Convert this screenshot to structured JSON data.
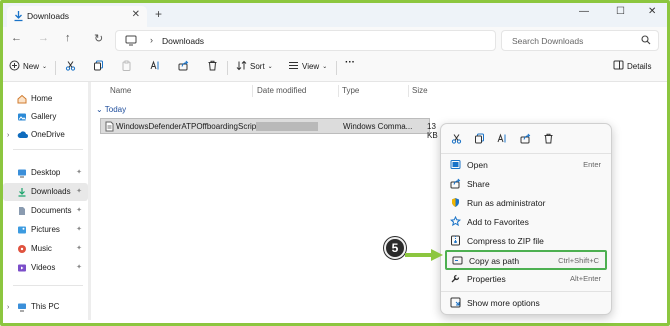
{
  "window": {
    "tab_title": "Downloads",
    "tab_close": "✕",
    "new_tab": "+",
    "controls": [
      "—",
      "☐",
      "✕"
    ]
  },
  "nav": {
    "back": "←",
    "forward": "→",
    "up": "↑",
    "refresh": "↻",
    "chevron": "›",
    "path": "Downloads",
    "search_placeholder": "Search Downloads"
  },
  "toolbar": {
    "new_label": "New",
    "sort_label": "Sort",
    "view_label": "View",
    "more_label": "···",
    "details_label": "Details"
  },
  "sidebar": {
    "items": [
      {
        "label": "Home",
        "icon": "home-icon"
      },
      {
        "label": "Gallery",
        "icon": "gallery-icon"
      },
      {
        "label": "OneDrive",
        "icon": "cloud-icon"
      },
      {
        "label": "Desktop",
        "icon": "desktop-icon"
      },
      {
        "label": "Downloads",
        "icon": "download-icon"
      },
      {
        "label": "Documents",
        "icon": "documents-icon"
      },
      {
        "label": "Pictures",
        "icon": "pictures-icon"
      },
      {
        "label": "Music",
        "icon": "music-icon"
      },
      {
        "label": "Videos",
        "icon": "videos-icon"
      },
      {
        "label": "This PC",
        "icon": "pc-icon"
      }
    ],
    "pin": "📌"
  },
  "list": {
    "columns": [
      "Name",
      "Date modified",
      "Type",
      "Size"
    ],
    "group": "Today",
    "files": [
      {
        "name": "WindowsDefenderATPOffboardingScript...",
        "type": "Windows Comma...",
        "size": "13 KB"
      }
    ]
  },
  "context_menu": {
    "toolbar_icons": [
      "cut-icon",
      "copy-icon",
      "rename-icon",
      "share-icon",
      "delete-icon"
    ],
    "items": [
      {
        "label": "Open",
        "shortcut": "Enter",
        "icon": "open-icon"
      },
      {
        "label": "Share",
        "shortcut": "",
        "icon": "share-icon"
      },
      {
        "label": "Run as administrator",
        "shortcut": "",
        "icon": "shield-icon"
      },
      {
        "label": "Add to Favorites",
        "shortcut": "",
        "icon": "star-icon"
      },
      {
        "label": "Compress to ZIP file",
        "shortcut": "",
        "icon": "zip-icon"
      },
      {
        "label": "Copy as path",
        "shortcut": "Ctrl+Shift+C",
        "icon": "path-icon"
      },
      {
        "label": "Properties",
        "shortcut": "Alt+Enter",
        "icon": "wrench-icon"
      },
      {
        "label": "Show more options",
        "shortcut": "",
        "icon": "more-options-icon"
      }
    ],
    "highlighted": "Copy as path"
  },
  "callout": {
    "step": "5",
    "color": "#8cc63f"
  },
  "colors": {
    "accent": "#0067c0",
    "frame": "#8cc63f",
    "highlight_border": "#4caf50"
  }
}
